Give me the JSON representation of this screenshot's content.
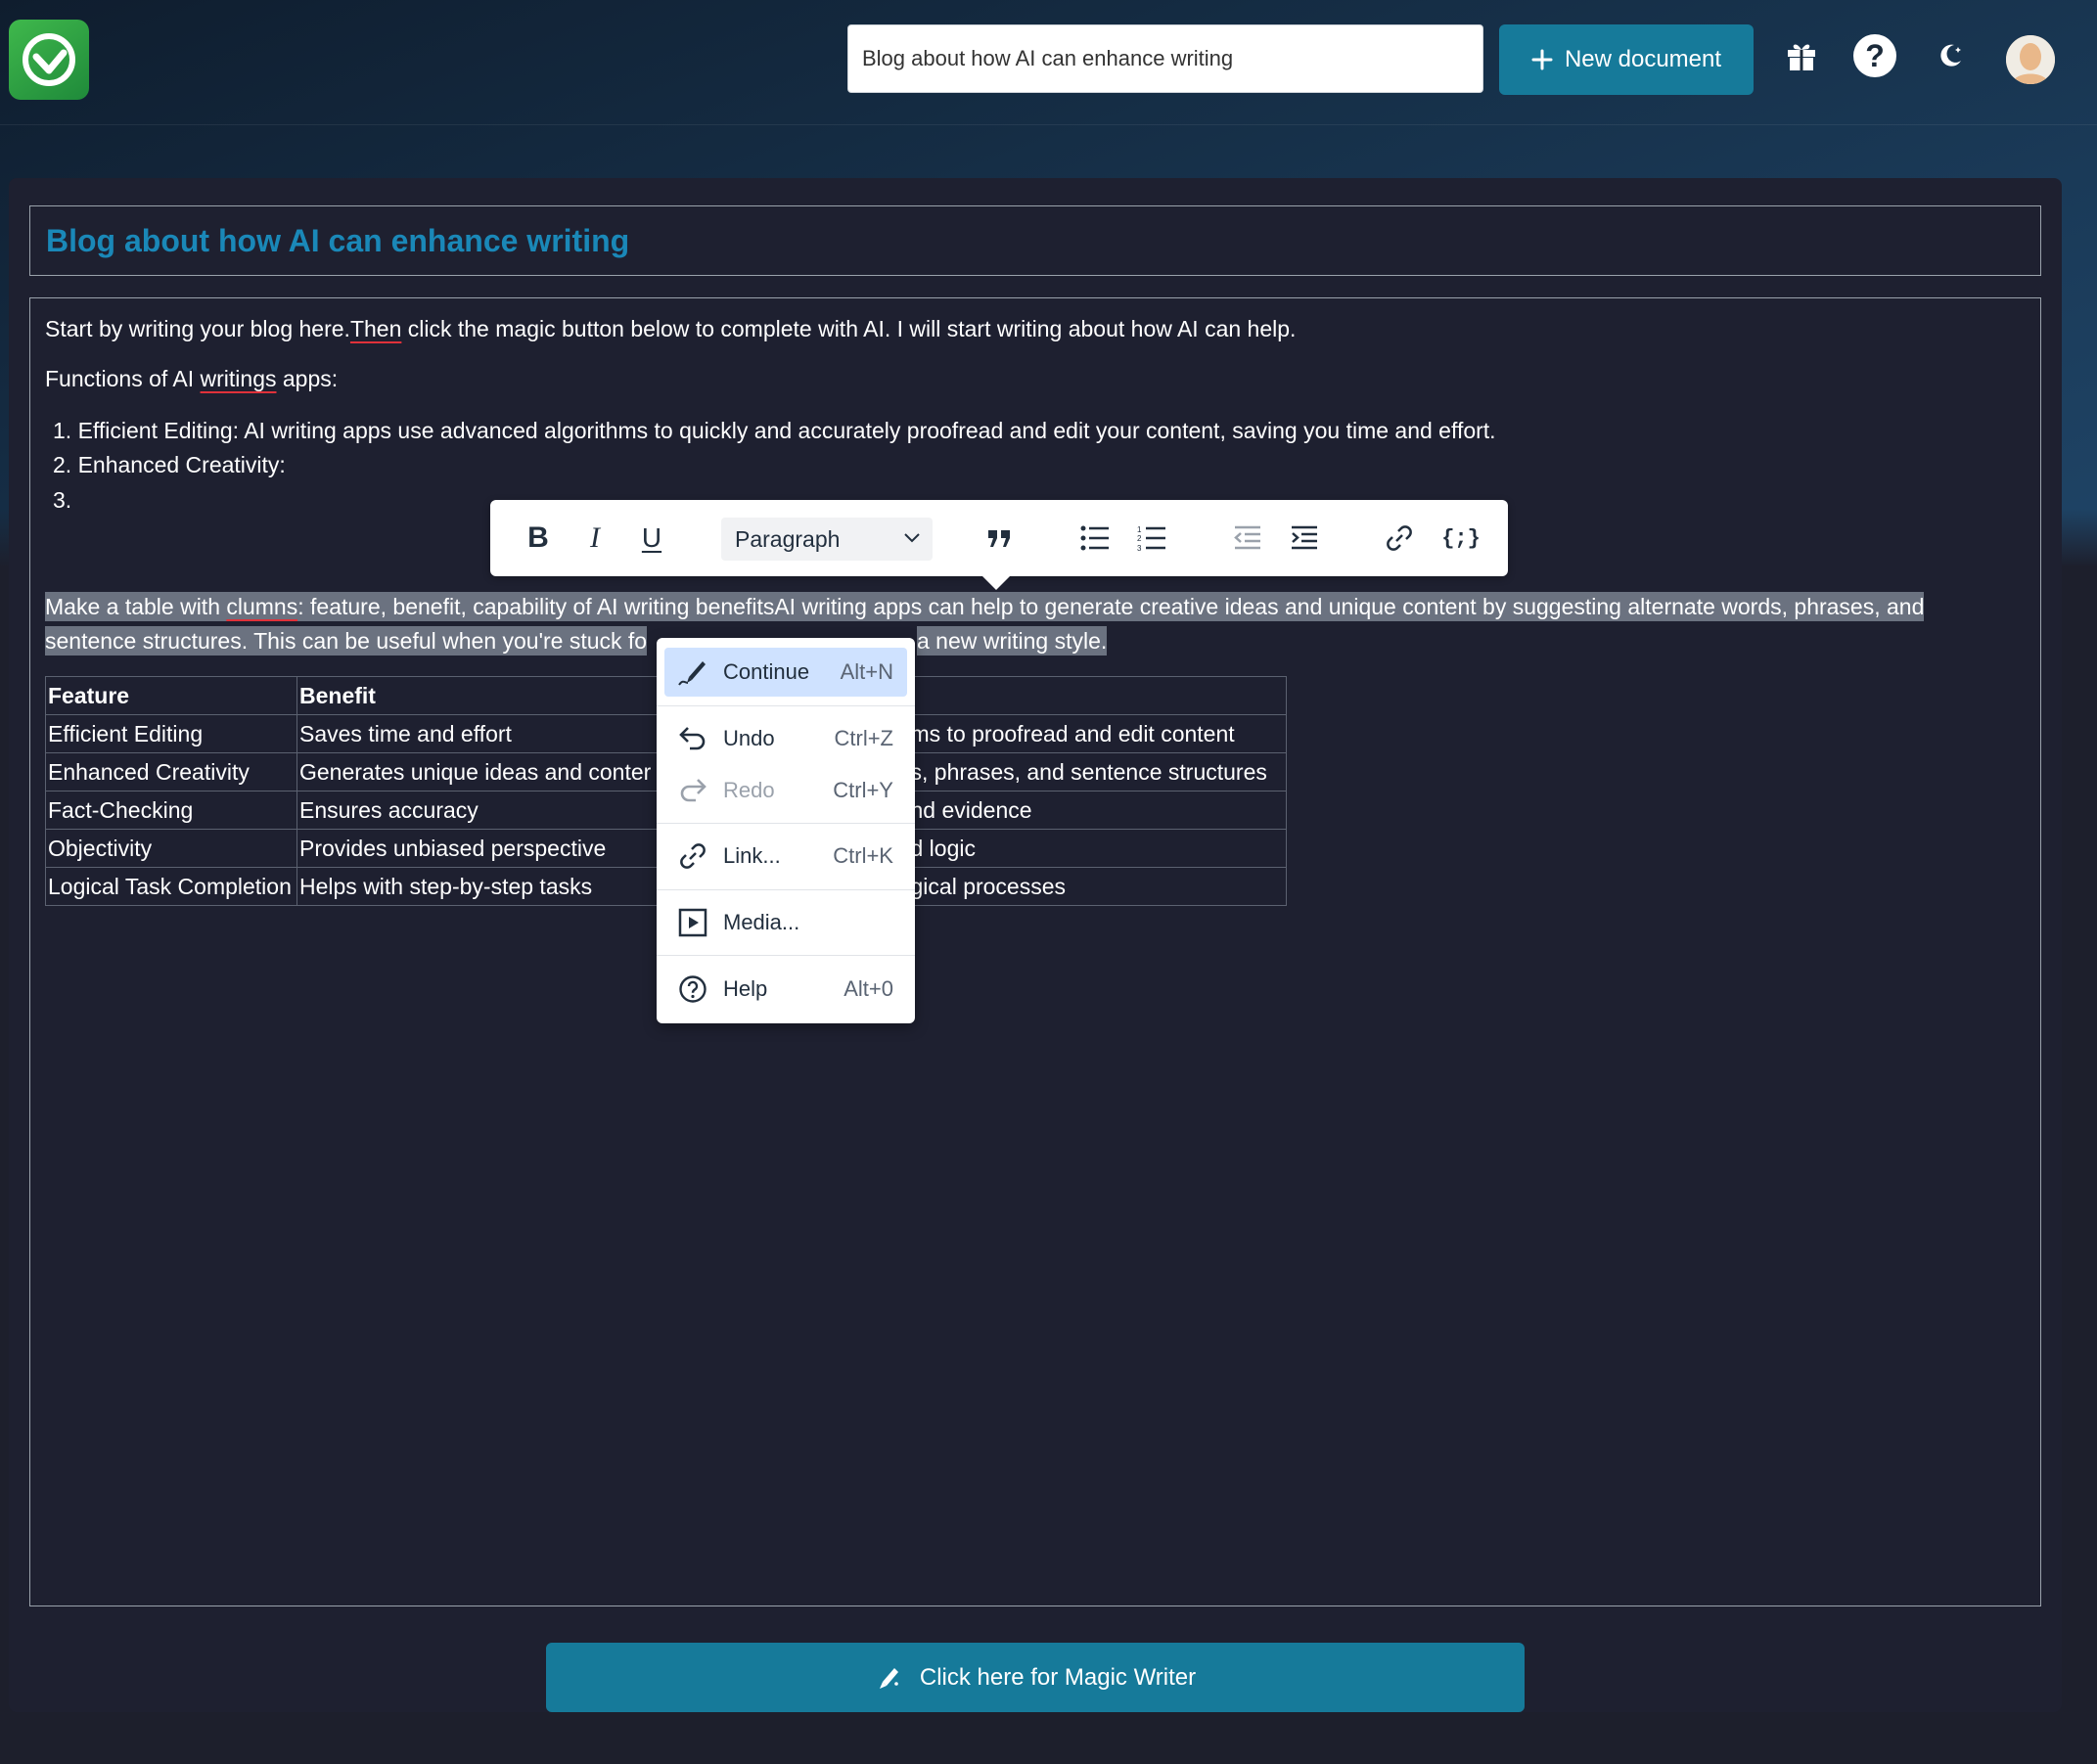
{
  "header": {
    "search_value": "Blog about how AI can enhance writing",
    "new_document_label": "New document",
    "help_glyph": "?"
  },
  "document": {
    "title": "Blog about how AI can enhance writing",
    "intro_before": "Start by writing your blog here.",
    "intro_misspelled": "Then",
    "intro_after": " click the magic button below to complete with AI. I will start writing about how AI can help.",
    "functions_before": "Functions of AI ",
    "functions_misspelled": "writings",
    "functions_after": " apps:",
    "list": [
      "1. Efficient Editing: AI writing apps use advanced algorithms to quickly and accurately proofread and edit your content, saving you time and effort.",
      "2. Enhanced Creativity:",
      "3."
    ],
    "selected_line1_before": "Make a table with ",
    "selected_line1_misspelled": "clumns",
    "selected_line1_after": ": feature, benefit, capability of AI writing benefitsAI writing apps can help to generate creative ideas and unique content by suggesting alternate words, phrases, and",
    "selected_line2_left": "sentence structures. This can be useful when you're stuck fo",
    "selected_line2_right": "a new writing style."
  },
  "table": {
    "headers": [
      "Feature",
      "Benefit"
    ],
    "rows": [
      {
        "feature": "Efficient Editing",
        "benefit": "Saves time and effort",
        "capability": "ms to proofread and edit content"
      },
      {
        "feature": "Enhanced Creativity",
        "benefit": "Generates unique ideas and conter",
        "capability": "s, phrases, and sentence structures"
      },
      {
        "feature": "Fact-Checking",
        "benefit": "Ensures accuracy",
        "capability": "nd evidence"
      },
      {
        "feature": "Objectivity",
        "benefit": "Provides unbiased perspective",
        "capability": "d logic"
      },
      {
        "feature": "Logical Task Completion",
        "benefit": "Helps with step-by-step tasks",
        "capability": "gical processes"
      }
    ]
  },
  "toolbar": {
    "bold": "B",
    "italic": "I",
    "underline": "U",
    "block_format": "Paragraph",
    "code_sample": "{;}"
  },
  "context_menu": {
    "items": [
      {
        "label": "Continue",
        "shortcut": "Alt+N",
        "icon": "pen-icon"
      },
      {
        "label": "Undo",
        "shortcut": "Ctrl+Z",
        "icon": "undo-icon"
      },
      {
        "label": "Redo",
        "shortcut": "Ctrl+Y",
        "icon": "redo-icon"
      },
      {
        "label": "Link...",
        "shortcut": "Ctrl+K",
        "icon": "link-icon"
      },
      {
        "label": "Media...",
        "shortcut": "",
        "icon": "media-icon"
      },
      {
        "label": "Help",
        "shortcut": "Alt+0",
        "icon": "help-icon"
      }
    ]
  },
  "magic_button": {
    "label": "Click here for Magic Writer"
  },
  "colors": {
    "accent": "#167a9a",
    "title": "#1a88b8",
    "spellcheck": "#e0313a",
    "menu_active": "#cfe2ff"
  }
}
